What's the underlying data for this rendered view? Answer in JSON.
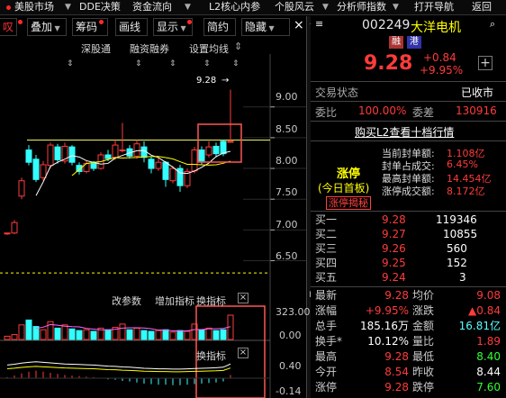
{
  "menu": [
    "美股市场",
    "DDE决策",
    "资金流向",
    "L2核心内参",
    "个股风云",
    "分析师指数",
    "打开导航",
    "返回"
  ],
  "menu_dropdown_marks": [
    true,
    false,
    true,
    false,
    true,
    true,
    false,
    false
  ],
  "toolbar": {
    "fq": "叹",
    "overlay": "叠加",
    "chips": "筹码",
    "draw": "画线",
    "show": "显示",
    "favorite": "简约",
    "hide": "隐藏"
  },
  "chart_header": {
    "a": "深股通",
    "b": "融资融券",
    "c": "设置均线"
  },
  "price_axis": [
    "9.00",
    "8.50",
    "8.00",
    "7.50",
    "7.00",
    "6.50"
  ],
  "high_label": "9.28",
  "vol_header": {
    "a": "改参数",
    "b": "增加指标",
    "c": "换指标"
  },
  "vol_axis": [
    "323.00",
    "0.00"
  ],
  "osc_header": "换指标",
  "osc_axis": [
    "0.40",
    "-0.14"
  ],
  "chart_data": {
    "type": "candlestick",
    "y_ticks": [
      9.0,
      8.5,
      8.0,
      7.5,
      7.0,
      6.5
    ],
    "ylim": [
      6.2,
      9.45
    ],
    "highlight_level": 8.46,
    "dashed_level": 6.3,
    "candles": [
      {
        "o": 6.95,
        "c": 6.95,
        "h": 6.95,
        "l": 6.92
      },
      {
        "o": 6.95,
        "c": 7.12,
        "h": 7.16,
        "l": 6.93
      },
      {
        "o": 7.55,
        "c": 7.8,
        "h": 7.85,
        "l": 7.5
      },
      {
        "o": 8.3,
        "c": 8.1,
        "h": 8.38,
        "l": 8.05
      },
      {
        "o": 8.15,
        "c": 7.82,
        "h": 8.22,
        "l": 7.78
      },
      {
        "o": 7.85,
        "c": 8.06,
        "h": 8.12,
        "l": 7.8
      },
      {
        "o": 8.05,
        "c": 8.38,
        "h": 8.42,
        "l": 8.0
      },
      {
        "o": 8.35,
        "c": 8.14,
        "h": 8.4,
        "l": 8.08
      },
      {
        "o": 8.12,
        "c": 8.36,
        "h": 8.42,
        "l": 8.08
      },
      {
        "o": 8.35,
        "c": 8.1,
        "h": 8.38,
        "l": 8.05
      },
      {
        "o": 8.05,
        "c": 7.95,
        "h": 8.1,
        "l": 7.9
      },
      {
        "o": 7.95,
        "c": 8.08,
        "h": 8.12,
        "l": 7.92
      },
      {
        "o": 8.08,
        "c": 8.0,
        "h": 8.12,
        "l": 7.96
      },
      {
        "o": 8.0,
        "c": 8.22,
        "h": 8.26,
        "l": 7.98
      },
      {
        "o": 8.22,
        "c": 8.16,
        "h": 8.3,
        "l": 8.12
      },
      {
        "o": 8.18,
        "c": 8.38,
        "h": 8.46,
        "l": 8.14
      },
      {
        "o": 8.3,
        "c": 8.3,
        "h": 8.74,
        "l": 8.26
      },
      {
        "o": 8.32,
        "c": 8.2,
        "h": 8.38,
        "l": 8.16
      },
      {
        "o": 8.2,
        "c": 8.4,
        "h": 8.46,
        "l": 8.16
      },
      {
        "o": 8.35,
        "c": 8.18,
        "h": 8.44,
        "l": 8.1
      },
      {
        "o": 8.15,
        "c": 8.0,
        "h": 8.2,
        "l": 7.92
      },
      {
        "o": 8.0,
        "c": 8.1,
        "h": 8.18,
        "l": 7.96
      },
      {
        "o": 8.1,
        "c": 7.82,
        "h": 8.12,
        "l": 7.7
      },
      {
        "o": 7.8,
        "c": 8.0,
        "h": 8.04,
        "l": 7.76
      },
      {
        "o": 8.0,
        "c": 7.72,
        "h": 8.06,
        "l": 7.62
      },
      {
        "o": 7.72,
        "c": 7.95,
        "h": 8.0,
        "l": 7.68
      },
      {
        "o": 7.96,
        "c": 8.3,
        "h": 8.35,
        "l": 7.92
      },
      {
        "o": 8.3,
        "c": 8.12,
        "h": 8.36,
        "l": 8.06
      },
      {
        "o": 8.22,
        "c": 8.35,
        "h": 8.44,
        "l": 8.18
      },
      {
        "o": 8.36,
        "c": 8.24,
        "h": 8.42,
        "l": 8.18
      },
      {
        "o": 8.44,
        "c": 8.24,
        "h": 8.46,
        "l": 8.2
      },
      {
        "o": 8.44,
        "c": 8.44,
        "h": 9.28,
        "l": 8.44
      }
    ],
    "volume": [
      20,
      30,
      90,
      120,
      80,
      60,
      110,
      70,
      90,
      65,
      55,
      60,
      50,
      70,
      60,
      75,
      95,
      60,
      70,
      55,
      50,
      55,
      60,
      45,
      55,
      50,
      95,
      60,
      70,
      55,
      60,
      150
    ],
    "macd": [
      0.02,
      0.05,
      0.09,
      0.12,
      0.14,
      0.12,
      0.1,
      0.08,
      0.06,
      0.05,
      0.04,
      0.03,
      0.02,
      0.0,
      -0.02,
      -0.03,
      -0.05,
      -0.06,
      -0.08,
      -0.1,
      -0.11,
      -0.12,
      -0.12,
      -0.13,
      -0.13,
      -0.12,
      -0.11,
      -0.1,
      -0.09,
      -0.08,
      -0.06,
      0.06
    ]
  },
  "quote": {
    "code": "002249",
    "name": "大洋电机",
    "tag1": "融",
    "tag2": "港",
    "price": "9.28",
    "change": "+0.84",
    "change_pct": "+9.95%",
    "status_label": "交易状态",
    "status_value": "已收市",
    "weibi_label": "委比",
    "weibi_value": "100.00%",
    "weicha_label": "委差",
    "weicha_value": "130916",
    "buy_l2": "购买L2查看十档行情",
    "limit_title": "涨停",
    "limit_sub": "(今日首板)",
    "limit_reveal": "涨停揭秘",
    "limit_stats": [
      {
        "label": "当前封单额:",
        "value": "1.108亿"
      },
      {
        "label": "封单占成交:",
        "value": "6.45%"
      },
      {
        "label": "最高封单额:",
        "value": "14.454亿"
      },
      {
        "label": "涨停成交额:",
        "value": "8.172亿"
      }
    ],
    "bids": [
      {
        "label": "买一",
        "price": "9.28",
        "vol": "119346"
      },
      {
        "label": "买二",
        "price": "9.27",
        "vol": "10855"
      },
      {
        "label": "买三",
        "price": "9.26",
        "vol": "560"
      },
      {
        "label": "买四",
        "price": "9.25",
        "vol": "152"
      },
      {
        "label": "买五",
        "price": "9.24",
        "vol": "3"
      }
    ],
    "stats": [
      {
        "l1": "最新",
        "v1": "9.28",
        "c1": "up",
        "l2": "均价",
        "v2": "9.08",
        "c2": "up"
      },
      {
        "l1": "涨幅",
        "v1": "+9.95%",
        "c1": "up",
        "l2": "涨跌",
        "v2": "▲0.84",
        "c2": "up"
      },
      {
        "l1": "总手",
        "v1": "185.16万",
        "c1": "wh",
        "l2": "金额",
        "v2": "16.81亿",
        "c2": "cy"
      },
      {
        "l1": "换手*",
        "v1": "10.12%",
        "c1": "wh",
        "l2": "量比",
        "v2": "1.89",
        "c2": "up"
      },
      {
        "l1": "最高",
        "v1": "9.28",
        "c1": "up",
        "l2": "最低",
        "v2": "8.40",
        "c2": "dn"
      },
      {
        "l1": "今开",
        "v1": "8.54",
        "c1": "up",
        "l2": "昨收",
        "v2": "8.44",
        "c2": "wh"
      },
      {
        "l1": "涨停",
        "v1": "9.28",
        "c1": "up",
        "l2": "跌停",
        "v2": "7.60",
        "c2": "dn"
      }
    ]
  },
  "colors": {
    "up": "#ff3b3b",
    "down": "#33ffff",
    "ma5": "#ffffff",
    "ma10": "#ffff00",
    "highlight": "#ff5555"
  }
}
